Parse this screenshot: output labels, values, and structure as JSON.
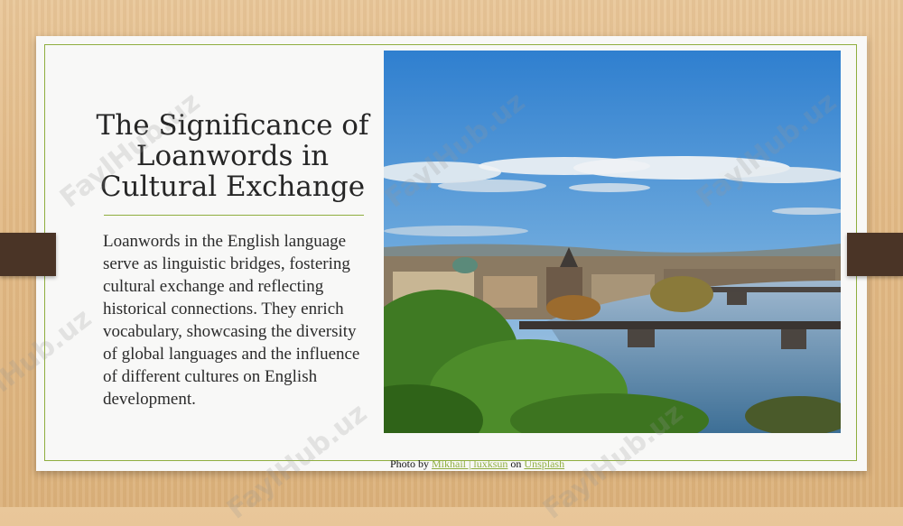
{
  "slide": {
    "title": "The Significance of Loanwords in Cultural Exchange",
    "body": "Loanwords in the English language serve as linguistic bridges, fostering cultural exchange and reflecting historical connections. They enrich vocabulary, showcasing the diversity of global languages and the influence of different cultures on English development.",
    "photo_alt": "Photo",
    "accent_color": "#8fae3f"
  },
  "caption": {
    "prefix": "Photo by ",
    "author": "Mikhail | luxksun",
    "middle": " on ",
    "source": "Unsplash"
  },
  "watermark": "FaylHub.uz"
}
